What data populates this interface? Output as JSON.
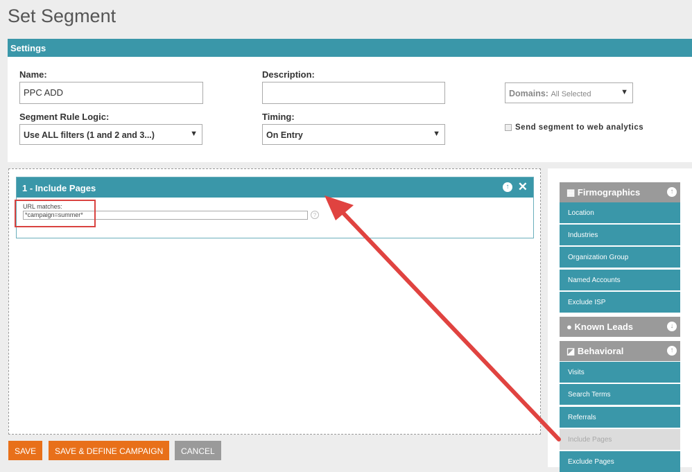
{
  "title": "Set Segment",
  "settings": {
    "header": "Settings",
    "name_label": "Name:",
    "name_value": "PPC ADD",
    "description_label": "Description:",
    "description_value": "",
    "logic_label": "Segment Rule Logic:",
    "logic_value": "Use ALL filters (1 and 2 and 3...)",
    "timing_label": "Timing:",
    "timing_value": "On Entry",
    "domains_label": "Domains:",
    "domains_value": "All Selected",
    "analytics_label": "Send segment to web analytics",
    "analytics_checked": false
  },
  "filter": {
    "title": "1 - Include Pages",
    "field_label": "URL matches:",
    "field_value": "*campaign=summer*"
  },
  "sidebar": {
    "groups": [
      {
        "label": "Firmographics",
        "items": [
          "Location",
          "Industries",
          "Organization Group",
          "Named Accounts",
          "Exclude ISP"
        ]
      },
      {
        "label": "Known Leads"
      },
      {
        "label": "Behavioral",
        "items": [
          "Visits",
          "Search Terms",
          "Referrals",
          "Include Pages",
          "Exclude Pages"
        ]
      }
    ]
  },
  "buttons": {
    "save": "SAVE",
    "save_define": "SAVE & DEFINE CAMPAIGN",
    "cancel": "CANCEL"
  }
}
